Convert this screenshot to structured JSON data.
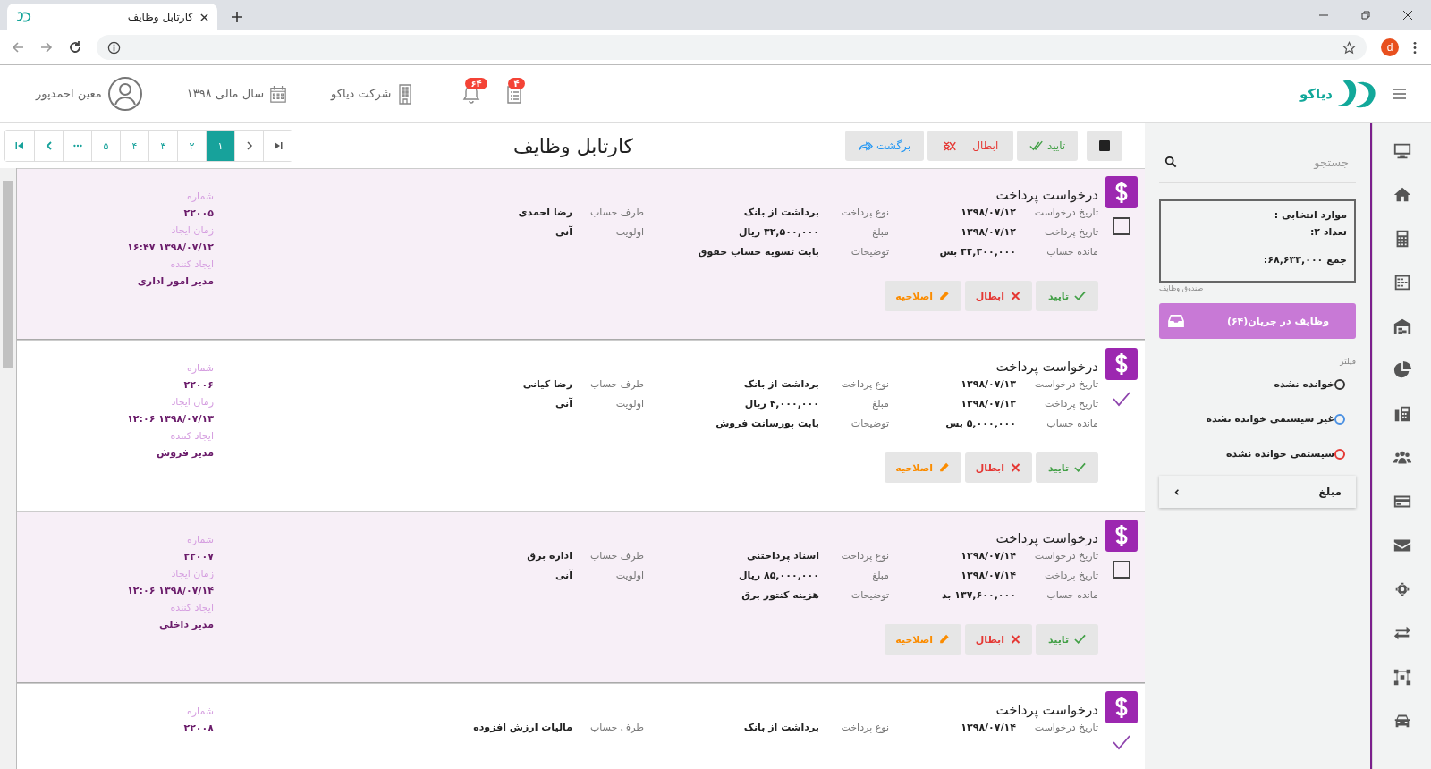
{
  "browser": {
    "tab_title": "کارتابل وظایف",
    "avatar": "d"
  },
  "header": {
    "logo": "دیاکو",
    "badges": [
      {
        "kind": "tasks",
        "count": "۴"
      },
      {
        "kind": "notifications",
        "count": "۶۴"
      }
    ],
    "company": "شرکت دیاکو",
    "fiscal_year": "سال مالی ۱۳۹۸",
    "user": "معین احمدپور"
  },
  "toolbar": {
    "buttons": [
      {
        "kind": "approve",
        "label": "تایید"
      },
      {
        "kind": "cancel",
        "label": "ابطال"
      },
      {
        "kind": "return",
        "label": "برگشت"
      }
    ],
    "title": "کارتابل وظایف",
    "pages": [
      {
        "label": "۱",
        "selected": true
      },
      {
        "label": "۲",
        "selected": false
      },
      {
        "label": "۳",
        "selected": false
      },
      {
        "label": "۴",
        "selected": false
      },
      {
        "label": "۵",
        "selected": false
      }
    ]
  },
  "cards": [
    {
      "title": "درخواست پرداخت",
      "checked": false,
      "fields": [
        [
          {
            "label": "تاریخ درخواست",
            "value": "۱۳۹۸/۰۷/۱۲"
          },
          {
            "label": "تاریخ پرداخت",
            "value": "۱۳۹۸/۰۷/۱۲"
          },
          {
            "label": "مانده حساب",
            "value": "۳۲,۳۰۰,۰۰۰ بس"
          }
        ],
        [
          {
            "label": "نوع پرداخت",
            "value": "برداشت از بانک"
          },
          {
            "label": "مبلغ",
            "value": "۳۲,۵۰۰,۰۰۰ ریال"
          },
          {
            "label": "توضیحات",
            "value": "بابت تسویه حساب حقوق"
          }
        ],
        [
          {
            "label": "طرف حساب",
            "value": "رضا احمدی"
          },
          {
            "label": "اولویت",
            "value": "آنی"
          }
        ]
      ],
      "meta": [
        {
          "label": "شماره",
          "value": "۲۲۰۰۵"
        },
        {
          "label": "زمان ایجاد",
          "value": "۱۳۹۸/۰۷/۱۲ ۱۶:۴۷"
        },
        {
          "label": "ایجاد کننده",
          "value": "مدیر امور اداری"
        }
      ],
      "actions": [
        {
          "kind": "approve",
          "label": "تایید"
        },
        {
          "kind": "cancel",
          "label": "ابطال"
        },
        {
          "kind": "edit",
          "label": "اصلاحیه"
        }
      ]
    },
    {
      "title": "درخواست پرداخت",
      "checked": true,
      "fields": [
        [
          {
            "label": "تاریخ درخواست",
            "value": "۱۳۹۸/۰۷/۱۳"
          },
          {
            "label": "تاریخ پرداخت",
            "value": "۱۳۹۸/۰۷/۱۳"
          },
          {
            "label": "مانده حساب",
            "value": "۵,۰۰۰,۰۰۰ بس"
          }
        ],
        [
          {
            "label": "نوع پرداخت",
            "value": "برداشت از بانک"
          },
          {
            "label": "مبلغ",
            "value": "۴,۰۰۰,۰۰۰ ریال"
          },
          {
            "label": "توضیحات",
            "value": "بابت پورسانت فروش"
          }
        ],
        [
          {
            "label": "طرف حساب",
            "value": "رضا کیانی"
          },
          {
            "label": "اولویت",
            "value": "آنی"
          }
        ]
      ],
      "meta": [
        {
          "label": "شماره",
          "value": "۲۲۰۰۶"
        },
        {
          "label": "زمان ایجاد",
          "value": "۱۳۹۸/۰۷/۱۳ ۱۲:۰۶"
        },
        {
          "label": "ایجاد کننده",
          "value": "مدیر فروش"
        }
      ],
      "actions": [
        {
          "kind": "approve",
          "label": "تایید"
        },
        {
          "kind": "cancel",
          "label": "ابطال"
        },
        {
          "kind": "edit",
          "label": "اصلاحیه"
        }
      ]
    },
    {
      "title": "درخواست پرداخت",
      "checked": false,
      "fields": [
        [
          {
            "label": "تاریخ درخواست",
            "value": "۱۳۹۸/۰۷/۱۴"
          },
          {
            "label": "تاریخ پرداخت",
            "value": "۱۳۹۸/۰۷/۱۴"
          },
          {
            "label": "مانده حساب",
            "value": "۱۳۷,۶۰۰,۰۰۰ بد"
          }
        ],
        [
          {
            "label": "نوع پرداخت",
            "value": "اسناد پرداختنی"
          },
          {
            "label": "مبلغ",
            "value": "۸۵,۰۰۰,۰۰۰ ریال"
          },
          {
            "label": "توضیحات",
            "value": "هزینه کنتور برق"
          }
        ],
        [
          {
            "label": "طرف حساب",
            "value": "اداره برق"
          },
          {
            "label": "اولویت",
            "value": "آنی"
          }
        ]
      ],
      "meta": [
        {
          "label": "شماره",
          "value": "۲۲۰۰۷"
        },
        {
          "label": "زمان ایجاد",
          "value": "۱۳۹۸/۰۷/۱۴ ۱۲:۰۶"
        },
        {
          "label": "ایجاد کننده",
          "value": "مدیر داخلی"
        }
      ],
      "actions": [
        {
          "kind": "approve",
          "label": "تایید"
        },
        {
          "kind": "cancel",
          "label": "ابطال"
        },
        {
          "kind": "edit",
          "label": "اصلاحیه"
        }
      ]
    },
    {
      "title": "درخواست پرداخت",
      "checked": true,
      "fields": [
        [
          {
            "label": "تاریخ درخواست",
            "value": "۱۳۹۸/۰۷/۱۴"
          }
        ],
        [
          {
            "label": "نوع پرداخت",
            "value": "برداشت از بانک"
          }
        ],
        [
          {
            "label": "طرف حساب",
            "value": "مالیات ارزش افزوده"
          }
        ]
      ],
      "meta": [
        {
          "label": "شماره",
          "value": "۲۲۰۰۸"
        }
      ]
    }
  ],
  "panel": {
    "search": {
      "placeholder": "جستجو"
    },
    "selection": [
      "موارد انتخابی :",
      "تعداد ۲:",
      "جمع ۶۸,۶۳۳,۰۰۰:"
    ],
    "box_label": "صندوق وظایف",
    "inbox_button": "وظایف در جریان(۶۴)",
    "filter_label": "فیلتر",
    "filters": [
      {
        "label": "خوانده نشده",
        "color": "#333333",
        "selected": false
      },
      {
        "label": "غیر سیستمی خوانده نشده",
        "color": "#4a90e2",
        "selected": false
      },
      {
        "label": "سیستمی خوانده نشده",
        "color": "#e53935",
        "selected": false
      }
    ],
    "amount": {
      "label": "مبلغ",
      "expanded": false
    }
  }
}
